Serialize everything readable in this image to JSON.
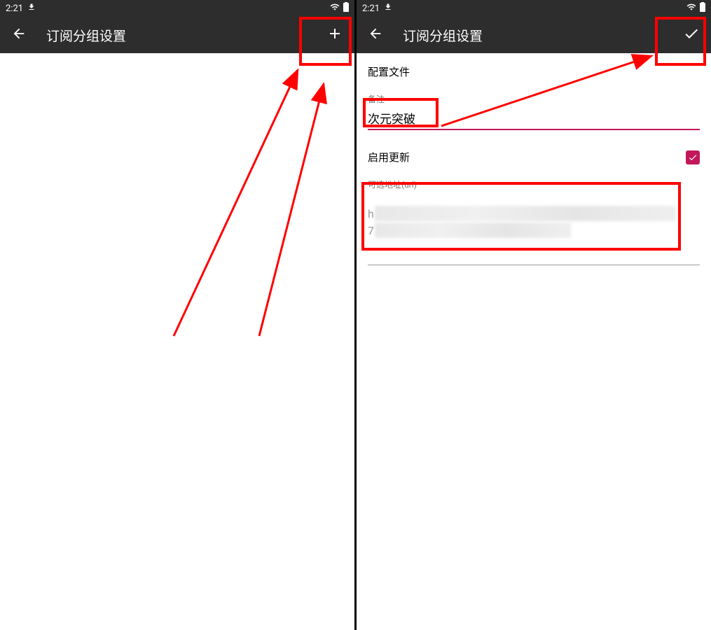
{
  "status": {
    "time": "2:21",
    "download_icon": "download"
  },
  "left_screen": {
    "app_bar_title": "订阅分组设置",
    "action": "add"
  },
  "right_screen": {
    "app_bar_title": "订阅分组设置",
    "action": "confirm",
    "section_title": "配置文件",
    "remark_label": "备注",
    "remark_value": "次元突破",
    "enable_update_label": "启用更新",
    "enable_update_checked": true,
    "url_label": "可选地址(url)",
    "url_line1": "h",
    "url_line2": "7"
  },
  "colors": {
    "appbar": "#2d2d2d",
    "accent": "#c2185b",
    "highlight": "#ff0000"
  }
}
